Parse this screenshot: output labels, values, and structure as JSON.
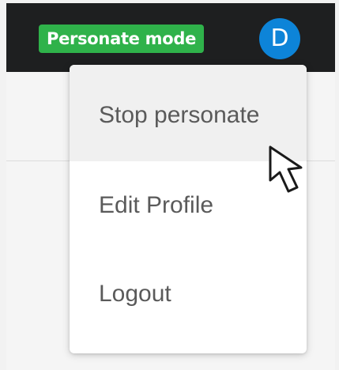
{
  "header": {
    "mode_badge": "Personate mode",
    "avatar_initial": "D"
  },
  "menu": {
    "items": [
      {
        "label": "Stop personate",
        "highlighted": true
      },
      {
        "label": "Edit Profile"
      },
      {
        "label": "Logout"
      }
    ]
  },
  "colors": {
    "topbar": "#1e1f20",
    "badge": "#2fb24a",
    "avatar": "#0d84d8",
    "menu_text": "#5a5a5a",
    "highlight": "#f0f0f0"
  },
  "icons": {
    "cursor": "mouse-pointer-icon"
  }
}
